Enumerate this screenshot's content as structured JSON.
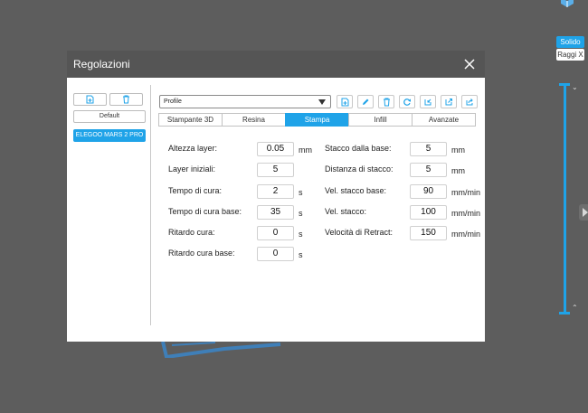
{
  "render_mode": {
    "solid": "Solido",
    "xray": "Raggi X"
  },
  "dialog": {
    "title": "Regolazioni",
    "left": {
      "items": [
        "Default",
        "ELEGOO MARS 2 PRO"
      ],
      "active_index": 1
    },
    "profile": {
      "value": "Profile"
    },
    "tabs": [
      "Stampante 3D",
      "Resina",
      "Stampa",
      "Infill",
      "Avanzate"
    ],
    "active_tab": "Stampa",
    "left_fields": [
      {
        "label": "Altezza layer:",
        "value": "0.05",
        "unit": "mm"
      },
      {
        "label": "Layer iniziali:",
        "value": "5",
        "unit": ""
      },
      {
        "label": "Tempo di cura:",
        "value": "2",
        "unit": "s"
      },
      {
        "label": "Tempo di cura base:",
        "value": "35",
        "unit": "s"
      },
      {
        "label": "Ritardo cura:",
        "value": "0",
        "unit": "s"
      },
      {
        "label": "Ritardo cura base:",
        "value": "0",
        "unit": "s"
      }
    ],
    "right_fields": [
      {
        "label": "Stacco dalla base:",
        "value": "5",
        "unit": "mm"
      },
      {
        "label": "Distanza di stacco:",
        "value": "5",
        "unit": "mm"
      },
      {
        "label": "Vel. stacco base:",
        "value": "90",
        "unit": "mm/min"
      },
      {
        "label": "Vel. stacco:",
        "value": "100",
        "unit": "mm/min"
      },
      {
        "label": "Velocità di Retract:",
        "value": "150",
        "unit": "mm/min"
      }
    ]
  },
  "colors": {
    "accent": "#1fa3e8",
    "header": "#555555",
    "background": "#5d5d5d"
  }
}
